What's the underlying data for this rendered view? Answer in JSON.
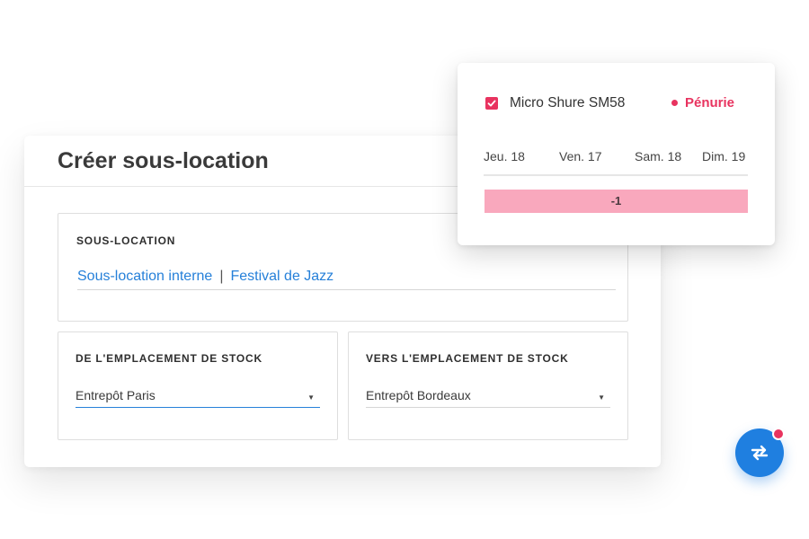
{
  "card": {
    "title": "Créer sous-location",
    "sous_location": {
      "label": "SOUS-LOCATION",
      "link_internal": "Sous-location interne",
      "separator": "|",
      "link_event": "Festival de Jazz"
    },
    "from_location": {
      "label": "DE L'EMPLACEMENT DE STOCK",
      "value": "Entrepôt Paris"
    },
    "to_location": {
      "label": "VERS L'EMPLACEMENT DE STOCK",
      "value": "Entrepôt Bordeaux"
    }
  },
  "popup": {
    "item_checked": true,
    "item_name": "Micro Shure SM58",
    "status": "Pénurie",
    "days": [
      "Jeu. 18",
      "Ven. 17",
      "Sam. 18",
      "Dim. 19"
    ],
    "shortage_value": "-1"
  },
  "fab": {
    "icon": "swap-arrows-icon",
    "has_notification": true
  },
  "colors": {
    "accent": "#2680d9",
    "alert": "#e8335f",
    "shortage_bg": "#f9a8bd",
    "fab": "#1f7fe0"
  }
}
